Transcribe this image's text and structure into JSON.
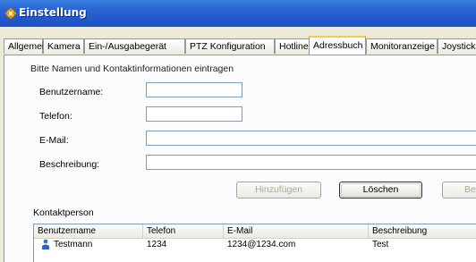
{
  "window": {
    "title": "Einstellung",
    "icon": "settings-app-icon"
  },
  "tabs": [
    {
      "label": "Allgemein"
    },
    {
      "label": "Kamera"
    },
    {
      "label": "Ein-/Ausgabegerät"
    },
    {
      "label": "PTZ Konfiguration"
    },
    {
      "label": "Hotline"
    },
    {
      "label": "Adressbuch"
    },
    {
      "label": "Monitoranzeige"
    },
    {
      "label": "Joystick"
    }
  ],
  "active_tab": "Adressbuch",
  "form": {
    "intro": "Bitte Namen und Kontaktinformationen eintragen",
    "username_label": "Benutzername:",
    "username_value": "",
    "phone_label": "Telefon:",
    "phone_value": "",
    "email_label": "E-Mail:",
    "email_value": "",
    "description_label": "Beschreibung:",
    "description_value": ""
  },
  "buttons": {
    "add_label": "Hinzufügen",
    "delete_label": "Löschen",
    "edit_label_partial": "Be"
  },
  "contacts": {
    "section_label": "Kontaktperson",
    "columns": [
      "Benutzername",
      "Telefon",
      "E-Mail",
      "Beschreibung"
    ],
    "rows": [
      {
        "name": "Testmann",
        "phone": "1234",
        "email": "1234@1234.com",
        "description": "Test",
        "icon": "user-icon"
      }
    ]
  },
  "colors": {
    "title_bar": "#2a64d2",
    "active_tab_accent": "#ffc83c",
    "field_border": "#7f9db9"
  }
}
